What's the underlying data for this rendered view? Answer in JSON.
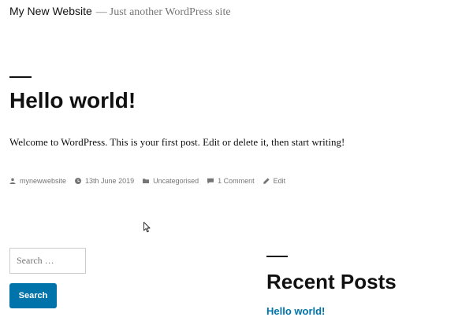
{
  "header": {
    "site_title": "My New Website",
    "separator": "—",
    "tagline": "Just another WordPress site"
  },
  "post": {
    "title": "Hello world!",
    "content": "Welcome to WordPress. This is your first post. Edit or delete it, then start writing!",
    "meta": {
      "author": "mynewwebsite",
      "date": "13th June 2019",
      "category": "Uncategorised",
      "comments": "1 Comment",
      "edit": "Edit"
    }
  },
  "sidebar": {
    "search": {
      "placeholder": "Search …",
      "button_label": "Search"
    },
    "recent_posts": {
      "title": "Recent Posts",
      "items": [
        "Hello world!"
      ]
    }
  },
  "colors": {
    "accent": "#0073aa",
    "meta_text": "#767676",
    "text": "#111111"
  }
}
